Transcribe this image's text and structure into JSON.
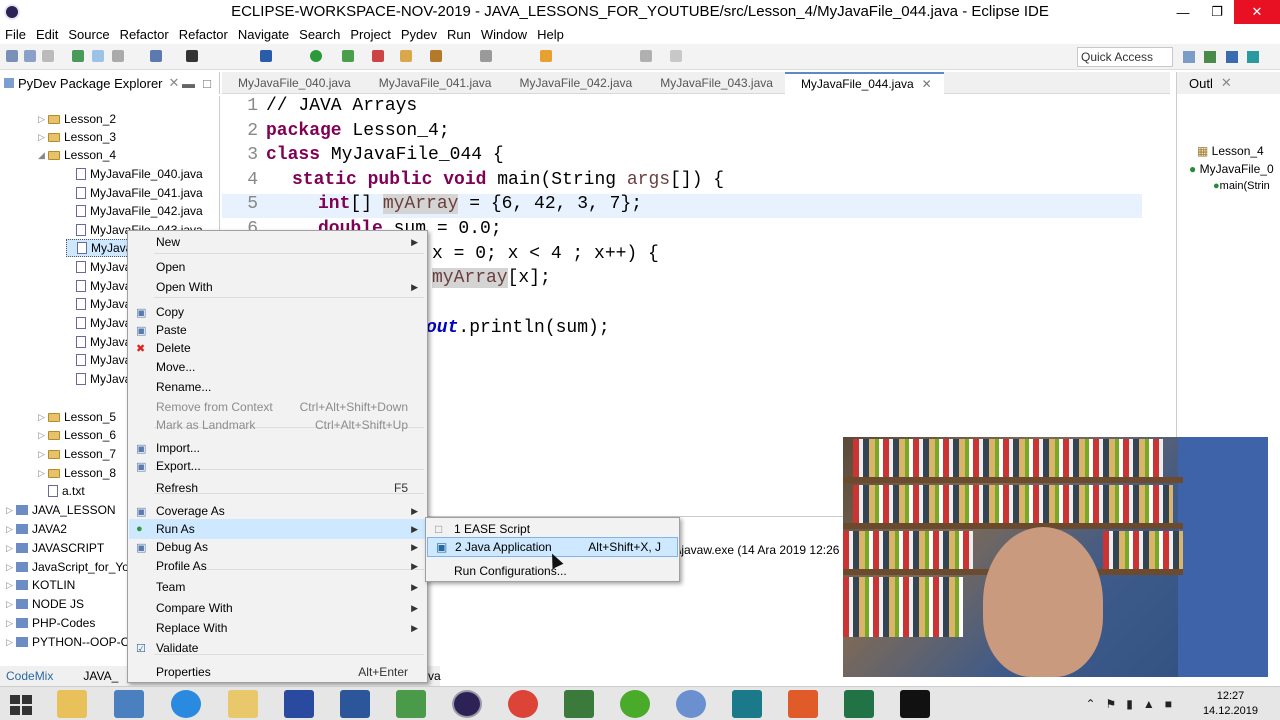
{
  "window": {
    "title": "ECLIPSE-WORKSPACE-NOV-2019 - JAVA_LESSONS_FOR_YOUTUBE/src/Lesson_4/MyJavaFile_044.java - Eclipse IDE"
  },
  "menu": [
    "File",
    "Edit",
    "Source",
    "Refactor",
    "Refactor",
    "Navigate",
    "Search",
    "Project",
    "Pydev",
    "Run",
    "Window",
    "Help"
  ],
  "quick_access": "Quick Access",
  "explorer": {
    "title": "PyDev Package Explorer",
    "rows": [
      {
        "label": "Lesson_2",
        "kind": "folder",
        "indent": 1
      },
      {
        "label": "Lesson_3",
        "kind": "folder",
        "indent": 1
      },
      {
        "label": "Lesson_4",
        "kind": "folder",
        "indent": 1,
        "open": true
      },
      {
        "label": "MyJavaFile_040.java",
        "kind": "file",
        "indent": 2
      },
      {
        "label": "MyJavaFile_041.java",
        "kind": "file",
        "indent": 2
      },
      {
        "label": "MyJavaFile_042.java",
        "kind": "file",
        "indent": 2
      },
      {
        "label": "MyJavaFile_043.java",
        "kind": "file",
        "indent": 2
      },
      {
        "label": "MyJavaF",
        "kind": "file",
        "indent": 2,
        "selected": true
      },
      {
        "label": "MyJavaF",
        "kind": "file",
        "indent": 2
      },
      {
        "label": "MyJavaF",
        "kind": "file",
        "indent": 2
      },
      {
        "label": "MyJavaF",
        "kind": "file",
        "indent": 2
      },
      {
        "label": "MyJavaF",
        "kind": "file",
        "indent": 2
      },
      {
        "label": "MyJavaF",
        "kind": "file",
        "indent": 2
      },
      {
        "label": "MyJavaF",
        "kind": "file",
        "indent": 2
      },
      {
        "label": "MyJavaF",
        "kind": "file",
        "indent": 2
      },
      {
        "label": "Lesson_5",
        "kind": "folder",
        "indent": 1
      },
      {
        "label": "Lesson_6",
        "kind": "folder",
        "indent": 1
      },
      {
        "label": "Lesson_7",
        "kind": "folder",
        "indent": 1
      },
      {
        "label": "Lesson_8",
        "kind": "folder",
        "indent": 1
      },
      {
        "label": "a.txt",
        "kind": "file",
        "indent": 1
      },
      {
        "label": "JAVA_LESSON",
        "kind": "project",
        "indent": 0
      },
      {
        "label": "JAVA2",
        "kind": "project",
        "indent": 0
      },
      {
        "label": "JAVASCRIPT",
        "kind": "project",
        "indent": 0
      },
      {
        "label": "JavaScript_for_Yo",
        "kind": "project",
        "indent": 0
      },
      {
        "label": "KOTLIN",
        "kind": "project",
        "indent": 0
      },
      {
        "label": "NODE JS",
        "kind": "project",
        "indent": 0
      },
      {
        "label": "PHP-Codes",
        "kind": "project",
        "indent": 0
      },
      {
        "label": "PYTHON--OOP-C",
        "kind": "project",
        "indent": 0
      }
    ]
  },
  "editor": {
    "tabs": [
      "MyJavaFile_040.java",
      "MyJavaFile_041.java",
      "MyJavaFile_042.java",
      "MyJavaFile_043.java",
      "MyJavaFile_044.java"
    ],
    "active_tab": "MyJavaFile_044.java",
    "line_numbers": [
      "1",
      "2",
      "3",
      "4",
      "5",
      "6"
    ],
    "line1": "// JAVA Arrays",
    "line2_kw": "package",
    "line2_rest": " Lesson_4;",
    "line3_kw": "class",
    "line3_rest": " MyJavaFile_044 {",
    "line4_kw": "static public void",
    "line4_rest": " main(String ",
    "line4_var": "args",
    "line4_end": "[]) {",
    "line5_kw": "int",
    "line5_a": "[] ",
    "line5_var": "myArray",
    "line5_b": " = {6, 42, 3, 7};",
    "line6_kw": "double",
    "line6_rest": " sum = 0.0;",
    "line7_rest": "x = 0; x < 4 ; x++) {",
    "line8_var": "myArray",
    "line8_rest": "[x];",
    "line10_fld": "out",
    "line10_rest": ".println(sum);"
  },
  "outline": {
    "title": "Outl",
    "items": [
      "Lesson_4",
      "MyJavaFile_0",
      "main(Strin"
    ]
  },
  "console": {
    "text": "\\javaw.exe (14 Ara 2019 12:26"
  },
  "status": {
    "left": "CodeMix",
    "mid": "JAVA_",
    "end": "va"
  },
  "context_menu": {
    "items": [
      {
        "label": "New",
        "submenu": true
      },
      {
        "label": "Open"
      },
      {
        "label": "Open With",
        "submenu": true
      },
      {
        "label": "Copy"
      },
      {
        "label": "Paste"
      },
      {
        "label": "Delete"
      },
      {
        "label": "Move..."
      },
      {
        "label": "Rename..."
      },
      {
        "label": "Remove from Context",
        "accel": "Ctrl+Alt+Shift+Down",
        "disabled": true
      },
      {
        "label": "Mark as Landmark",
        "accel": "Ctrl+Alt+Shift+Up",
        "disabled": true
      },
      {
        "label": "Import..."
      },
      {
        "label": "Export..."
      },
      {
        "label": "Refresh",
        "accel": "F5"
      },
      {
        "label": "Coverage As",
        "submenu": true
      },
      {
        "label": "Run As",
        "submenu": true,
        "hover": true
      },
      {
        "label": "Debug As",
        "submenu": true
      },
      {
        "label": "Profile As",
        "submenu": true
      },
      {
        "label": "Team",
        "submenu": true
      },
      {
        "label": "Compare With",
        "submenu": true
      },
      {
        "label": "Replace With",
        "submenu": true
      },
      {
        "label": "Validate"
      },
      {
        "label": "Properties",
        "accel": "Alt+Enter"
      }
    ]
  },
  "run_as_submenu": {
    "items": [
      {
        "label": "1 EASE Script"
      },
      {
        "label": "2 Java Application",
        "accel": "Alt+Shift+X, J",
        "hover": true
      },
      {
        "label": "Run Configurations..."
      }
    ]
  },
  "taskbar": {
    "time": "12:27",
    "date": "14.12.2019"
  },
  "icons": {
    "close": "close-icon",
    "start": "windows-start-icon",
    "delete": "delete-icon"
  }
}
